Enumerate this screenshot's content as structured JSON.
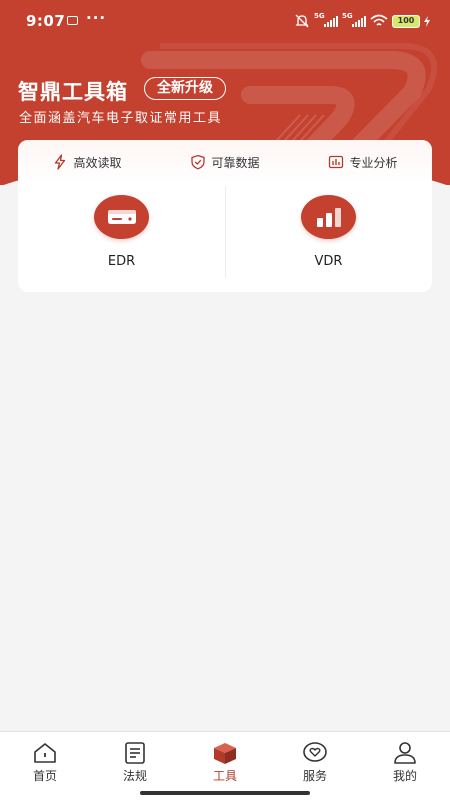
{
  "status_bar": {
    "time": "9:07",
    "more": "···",
    "network_1": "5G",
    "network_2": "5G",
    "battery": "100"
  },
  "header": {
    "title": "智鼎工具箱",
    "badge": "全新升级",
    "subtitle": "全面涵盖汽车电子取证常用工具"
  },
  "features": [
    {
      "label": "高效读取",
      "icon": "lightning-icon"
    },
    {
      "label": "可靠数据",
      "icon": "shield-check-icon"
    },
    {
      "label": "专业分析",
      "icon": "analysis-icon"
    }
  ],
  "tools": [
    {
      "label": "EDR",
      "icon": "edr-device-icon"
    },
    {
      "label": "VDR",
      "icon": "bar-chart-icon"
    }
  ],
  "tabs": [
    {
      "label": "首页",
      "icon": "home-icon",
      "active": false
    },
    {
      "label": "法规",
      "icon": "document-icon",
      "active": false
    },
    {
      "label": "工具",
      "icon": "toolbox-cube-icon",
      "active": true
    },
    {
      "label": "服务",
      "icon": "heart-chat-icon",
      "active": false
    },
    {
      "label": "我的",
      "icon": "user-icon",
      "active": false
    }
  ],
  "colors": {
    "brand": "#c4412f",
    "background": "#f4f4f4",
    "active_tab": "#b23a2b"
  }
}
